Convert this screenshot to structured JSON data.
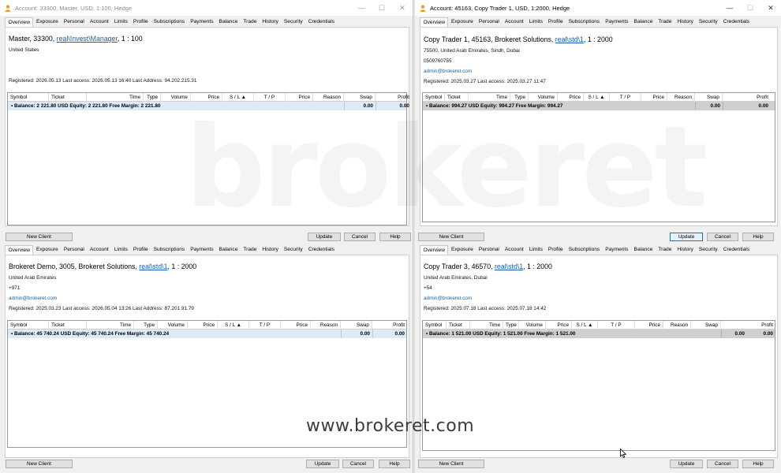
{
  "brand_watermark": "brokeret",
  "url_watermark": "www.brokeret.com",
  "tabs": [
    "Overview",
    "Exposure",
    "Personal",
    "Account",
    "Limits",
    "Profile",
    "Subscriptions",
    "Payments",
    "Balance",
    "Trade",
    "History",
    "Security",
    "Credentials"
  ],
  "columns": [
    "Symbol",
    "Ticket",
    "Time",
    "Type",
    "Volume",
    "Price",
    "S / L",
    "T / P",
    "Price",
    "Reason",
    "Swap",
    "Profit"
  ],
  "buttons": {
    "new_client": "New Client",
    "update": "Update",
    "cancel": "Cancel",
    "help": "Help"
  },
  "panels": {
    "tl": {
      "window_title": "Account: 33300, Master, USD, 1:100, Hedge",
      "header_prefix": "Master, 33300, ",
      "header_link": "real\\Invest\\Manager",
      "header_suffix": ", 1 : 100",
      "lines": [
        "United States"
      ],
      "registered": "Registered: 2026.05.13  Last access: 2026.05.13 16:40  Last Address: 94.202.215.31",
      "balance_line": "Balance: 2 221.80 USD  Equity: 2 221.80  Free Margin: 2 221.80",
      "swap": "0.00",
      "profit": "0.00"
    },
    "tr": {
      "window_title": "Account: 45163, Copy Trader 1, USD, 1:2000, Hedge",
      "header_prefix": "Copy Trader 1, 45163, Brokeret Solutions, ",
      "header_link": "real\\std\\1",
      "header_suffix": ", 1 : 2000",
      "lines": [
        "75500, United Arab Emirates, Sindh, Dubai",
        "0509760755"
      ],
      "email": "admin@brokeret.com",
      "registered": "Registered: 2025.03.27  Last access: 2025.03.27 11:47",
      "balance_line": "Balance: 994.27 USD  Equity: 994.27  Free Margin: 994.27",
      "swap": "0.00",
      "profit": "0.00"
    },
    "bl": {
      "header_prefix": "Brokeret Demo, 3005, Brokeret Solutions, ",
      "header_link": "real\\std\\1",
      "header_suffix": ", 1 : 2000",
      "lines": [
        "United Arab Emirates",
        "+971"
      ],
      "email": "admin@brokeret.com",
      "registered": "Registered: 2025.03.23  Last access: 2026.05.04 13:26  Last Address: 87.201.91.79",
      "balance_line": "Balance: 45 740.24 USD  Equity: 45 740.24  Free Margin: 45 740.24",
      "swap": "0.00",
      "profit": "0.00"
    },
    "br": {
      "header_prefix": "Copy Trader 3, 46570, ",
      "header_link": "real\\std\\1",
      "header_suffix": ", 1 : 2000",
      "lines": [
        "United Arab Emirates, Dubai",
        "+54"
      ],
      "email": "admin@brokeret.com",
      "registered": "Registered: 2025.07.18  Last access: 2025.07.18 14:42",
      "balance_line": "Balance: 1 521.00 USD  Equity: 1 521.00  Free Margin: 1 521.00",
      "swap": "0.00",
      "profit": "0.00"
    }
  }
}
